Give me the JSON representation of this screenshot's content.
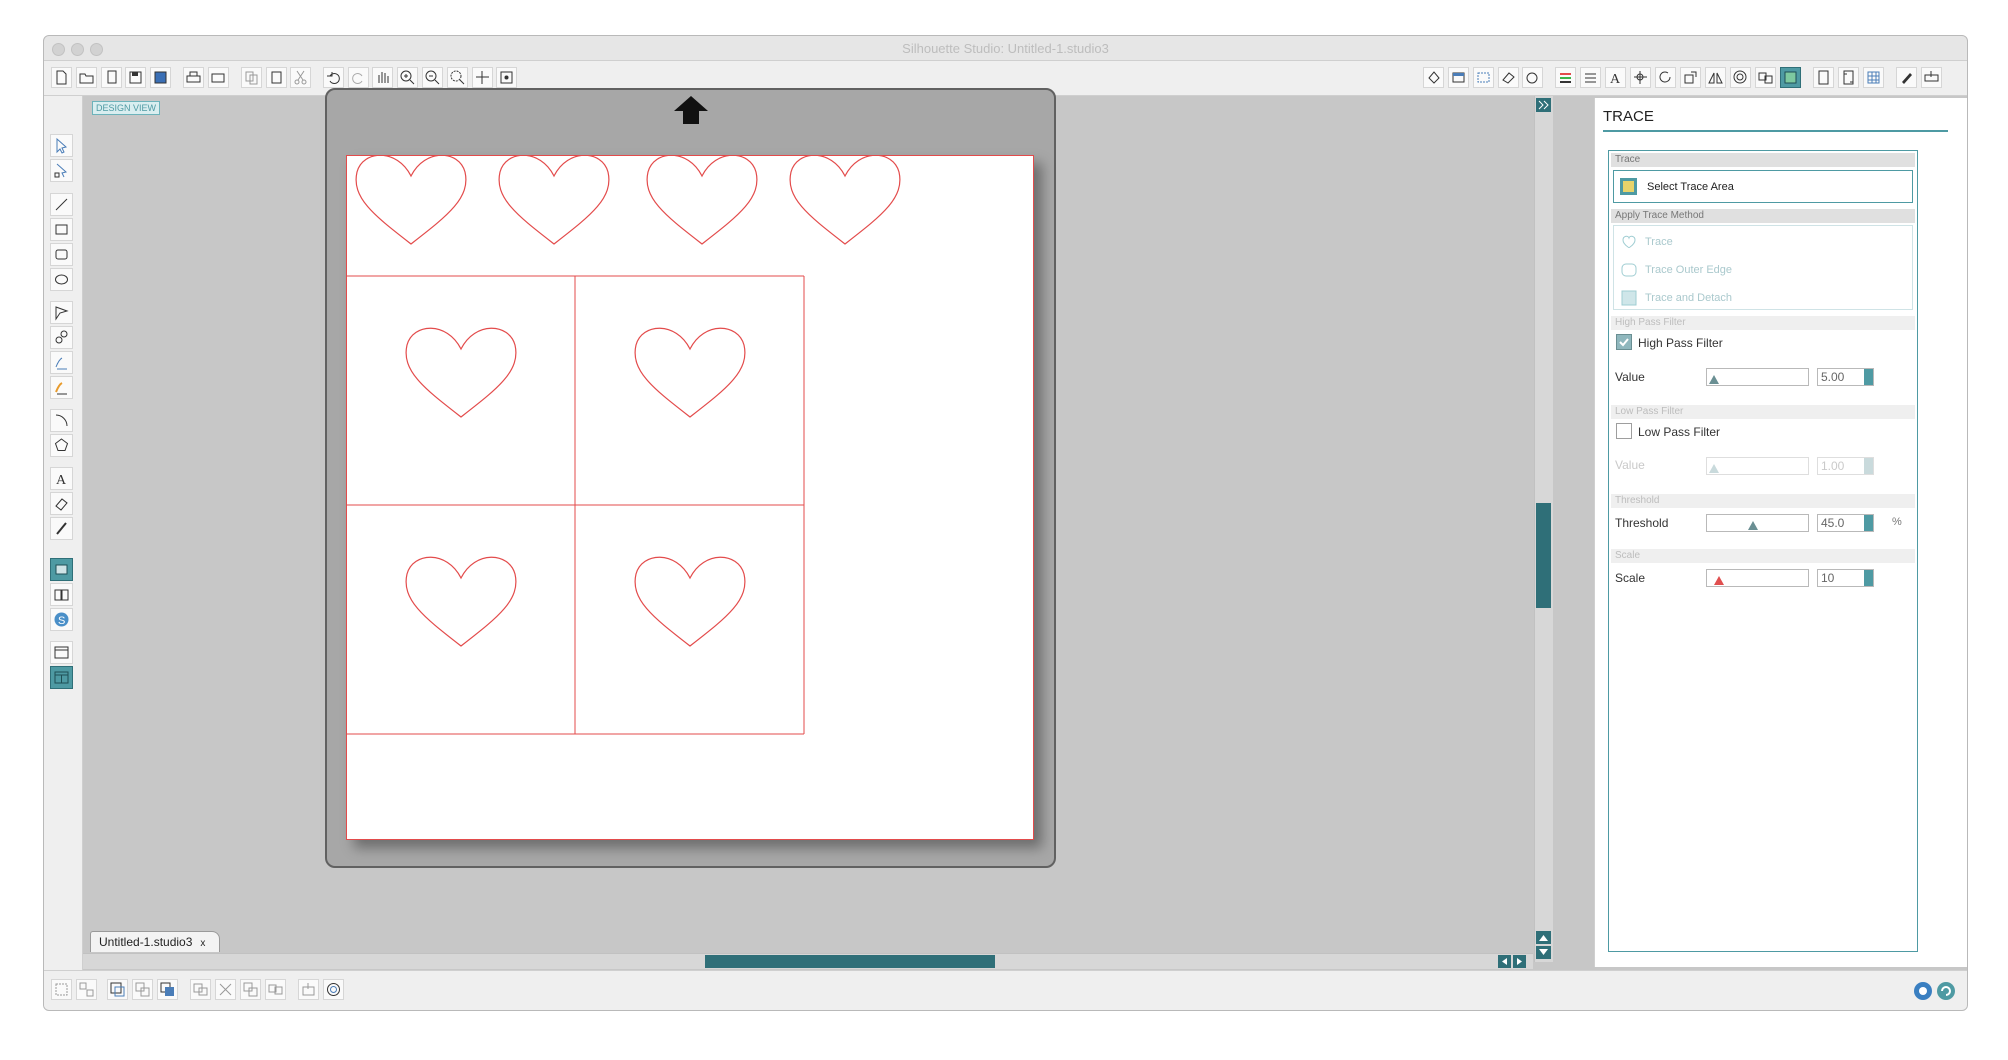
{
  "window": {
    "title": "Silhouette Studio: Untitled-1.studio3"
  },
  "design": {
    "view_tag": "DESIGN VIEW"
  },
  "document": {
    "tab_label": "Untitled-1.studio3",
    "close": "x"
  },
  "panel": {
    "title": "TRACE",
    "sections": {
      "trace": "Trace",
      "apply_method": "Apply Trace Method",
      "high_pass": "High Pass Filter",
      "low_pass": "Low Pass Filter",
      "threshold": "Threshold",
      "scale": "Scale"
    },
    "select_area_label": "Select Trace Area",
    "methods": [
      "Trace",
      "Trace Outer Edge",
      "Trace and Detach"
    ],
    "high_pass": {
      "checkbox_label": "High Pass Filter",
      "checked": true,
      "value_label": "Value",
      "value": "5.00",
      "level": 0.02
    },
    "low_pass": {
      "checkbox_label": "Low Pass Filter",
      "checked": false,
      "value_label": "Value",
      "value": "1.00",
      "level": 0.02
    },
    "threshold": {
      "label": "Threshold",
      "value": "45.0",
      "unit": "%",
      "level": 0.45
    },
    "scale": {
      "label": "Scale",
      "value": "10",
      "level": 0.08
    }
  },
  "colors": {
    "accent": "#4e9aa3",
    "accent_dark": "#2f6f78",
    "cut_line": "#e34b4b"
  }
}
